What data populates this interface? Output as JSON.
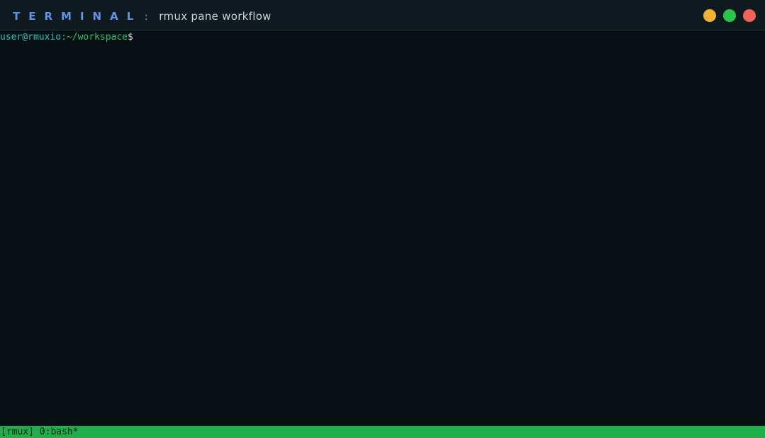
{
  "window": {
    "brand": "TERMINAL",
    "separator": ":",
    "title": "rmux pane workflow",
    "controls": {
      "minimize_color": "#f2b22e",
      "maximize_color": "#27c64a",
      "close_color": "#f0625b"
    }
  },
  "terminal": {
    "prompt": {
      "user_host": "user@rmuxio",
      "path": ":~/workspace",
      "symbol": "$"
    }
  },
  "statusbar": {
    "text": "[rmux] 0:bash*",
    "color": "#1fae4a"
  }
}
